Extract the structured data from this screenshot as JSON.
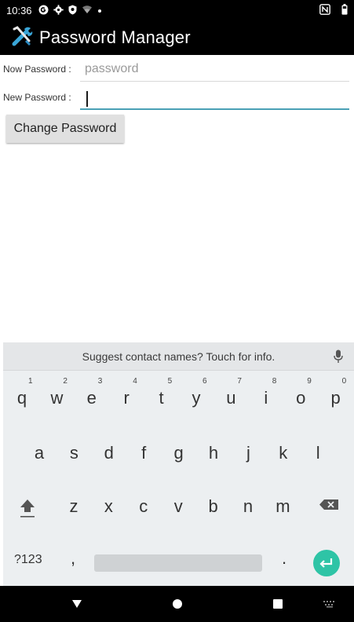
{
  "status_bar": {
    "time": "10:36",
    "icons": [
      "notification-g-icon",
      "settings-gear-icon",
      "shield-icon",
      "wifi-icon",
      "dot-icon",
      "nfc-icon",
      "battery-icon"
    ]
  },
  "action_bar": {
    "title": "Password Manager",
    "icon": "tools-icon"
  },
  "form": {
    "now_password_label": "Now Password :",
    "now_password_placeholder": "password",
    "now_password_value": "",
    "new_password_label": "New Password :",
    "new_password_value": "",
    "change_button_label": "Change Password"
  },
  "keyboard": {
    "suggestion": "Suggest contact names? Touch for info.",
    "row1": [
      {
        "ch": "q",
        "hint": "1"
      },
      {
        "ch": "w",
        "hint": "2"
      },
      {
        "ch": "e",
        "hint": "3"
      },
      {
        "ch": "r",
        "hint": "4"
      },
      {
        "ch": "t",
        "hint": "5"
      },
      {
        "ch": "y",
        "hint": "6"
      },
      {
        "ch": "u",
        "hint": "7"
      },
      {
        "ch": "i",
        "hint": "8"
      },
      {
        "ch": "o",
        "hint": "9"
      },
      {
        "ch": "p",
        "hint": "0"
      }
    ],
    "row2": [
      "a",
      "s",
      "d",
      "f",
      "g",
      "h",
      "j",
      "k",
      "l"
    ],
    "row3": [
      "z",
      "x",
      "c",
      "v",
      "b",
      "n",
      "m"
    ],
    "symbols_label": "?123",
    "comma_label": ",",
    "period_label": "."
  },
  "colors": {
    "bar_bg": "#000000",
    "accent_teal": "#2ec4a6",
    "focus_underline": "#4aa0b5",
    "keyboard_bg": "#eceff1",
    "button_bg": "#e0e0e0"
  }
}
